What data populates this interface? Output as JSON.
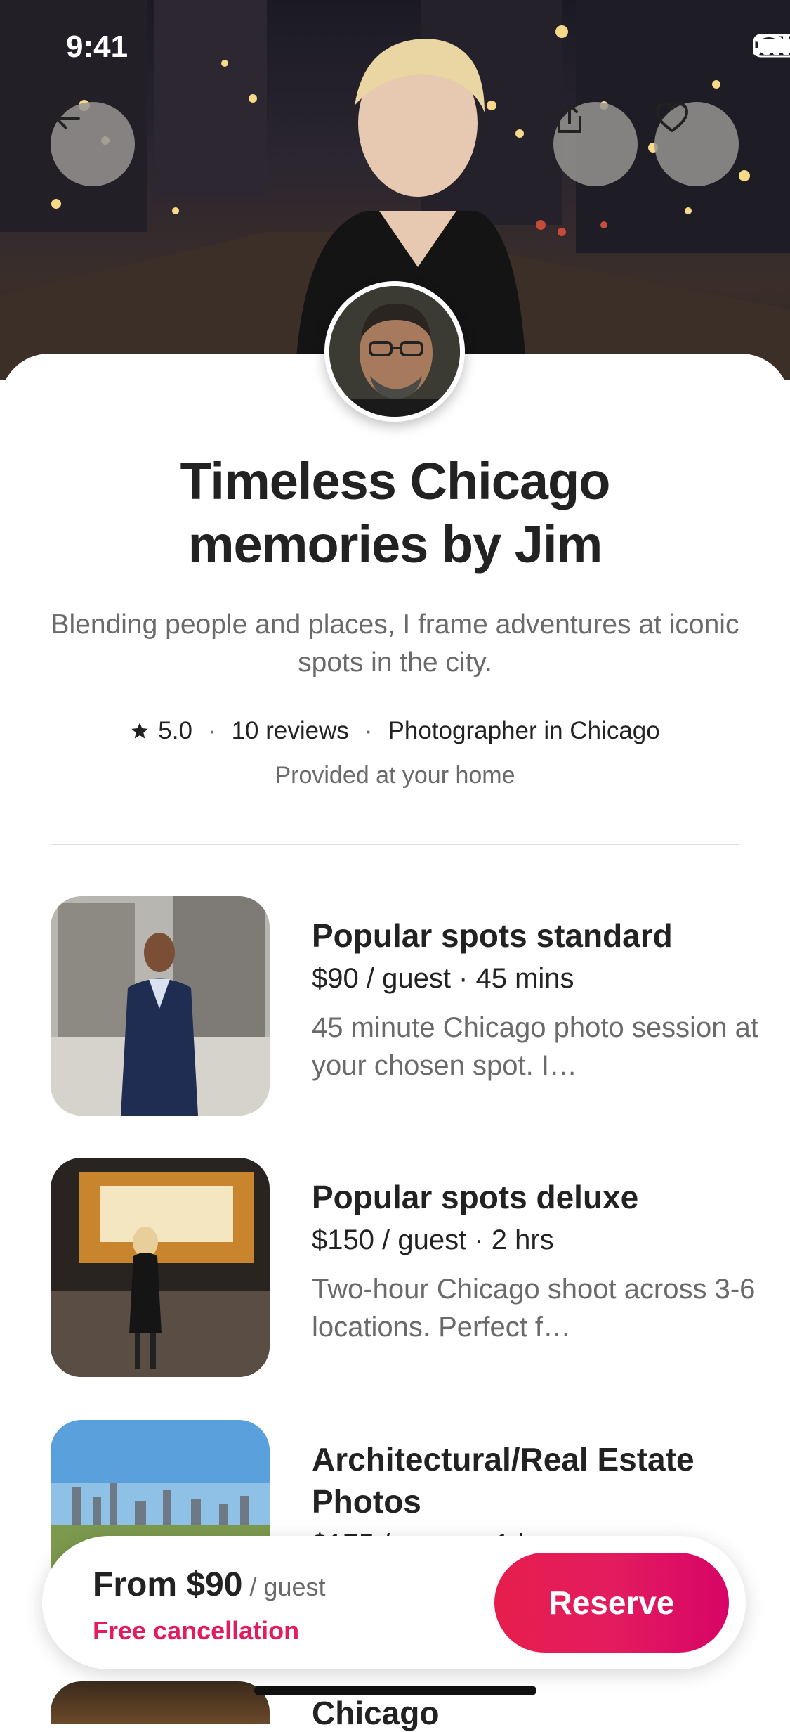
{
  "status_bar": {
    "time": "9:41"
  },
  "hero": {
    "back_label": "back",
    "share_label": "share",
    "save_label": "save"
  },
  "listing": {
    "title": "Timeless Chicago memories by Jim",
    "subtitle": "Blending people and places, I frame adventures at iconic spots in the city.",
    "rating": "5.0",
    "reviews": "10 reviews",
    "host_role": "Photographer in Chicago",
    "provided": "Provided at your home"
  },
  "services": [
    {
      "title": "Popular spots standard",
      "price": "$90 / guest · 45 mins",
      "description": "45 minute Chicago photo session at your chosen spot. I…"
    },
    {
      "title": "Popular spots deluxe",
      "price": "$150 / guest · 2 hrs",
      "description": "Two-hour Chicago shoot across 3-6 locations. Perfect f…"
    },
    {
      "title": "Architectural/Real Estate Photos",
      "price": "$175 / group · 1 hr",
      "description": ""
    }
  ],
  "next_item_peek": "Chicago ",
  "bottom_bar": {
    "from_label": "From $90",
    "per_label": "/ guest",
    "free_cancellation": "Free cancellation",
    "reserve_label": "Reserve"
  },
  "colors": {
    "accent": "#e31c5f",
    "text_primary": "#222222",
    "text_secondary": "#6a6a6a"
  }
}
